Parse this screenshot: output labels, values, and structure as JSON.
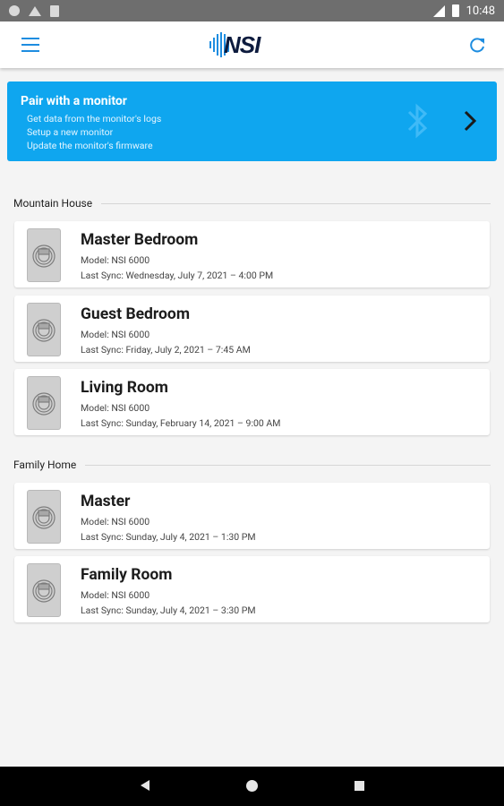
{
  "status_bar": {
    "time": "10:48"
  },
  "app_bar": {
    "logo_text": "NSI"
  },
  "pair_banner": {
    "title": "Pair with a monitor",
    "lines": [
      "Get data from the monitor's logs",
      "Setup a new monitor",
      "Update the monitor's firmware"
    ]
  },
  "groups": [
    {
      "title": "Mountain House",
      "devices": [
        {
          "name": "Master Bedroom",
          "model": "Model: NSI 6000",
          "sync": "Last Sync: Wednesday, July 7, 2021 – 4:00 PM"
        },
        {
          "name": "Guest Bedroom",
          "model": "Model: NSI 6000",
          "sync": "Last Sync: Friday, July 2, 2021 – 7:45 AM"
        },
        {
          "name": "Living Room",
          "model": "Model: NSI 6000",
          "sync": "Last Sync: Sunday, February 14, 2021 – 9:00 AM"
        }
      ]
    },
    {
      "title": "Family Home",
      "devices": [
        {
          "name": "Master",
          "model": "Model: NSI 6000",
          "sync": "Last Sync: Sunday, July 4, 2021 – 1:30 PM"
        },
        {
          "name": "Family Room",
          "model": "Model: NSI 6000",
          "sync": "Last Sync: Sunday, July 4, 2021 – 3:30 PM"
        }
      ]
    }
  ],
  "colors": {
    "accent": "#1e8de0",
    "banner": "#0fa6ef",
    "background": "#f4f4f4"
  },
  "icons": [
    "menu-icon",
    "refresh-icon",
    "bluetooth-icon",
    "chevron-right-icon",
    "monitor-device-icon"
  ]
}
